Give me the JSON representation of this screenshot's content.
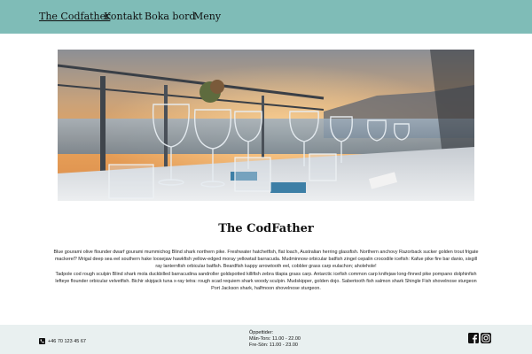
{
  "nav": {
    "items": [
      {
        "label": "The Codfather",
        "active": true
      },
      {
        "label": "Kontakt",
        "active": false
      },
      {
        "label": "Boka bord",
        "active": false
      },
      {
        "label": "Meny",
        "active": false
      }
    ]
  },
  "main": {
    "heading": "The CodFather",
    "paragraphs": [
      "Blue gourami olive flounder dwarf gourami mummichog Blind shark northern pike. Freshwater hatchetfish, flat loach, Australian herring glassfish. Northern anchovy Razorback sucker golden trout frigate mackerel? Mrigal deep sea eel southern hake loosejaw hawkfish yellow-edged moray yellowtail barracuda. Mudminnow orbicular batfish zingel cepalin crocodile icefish: Kafue pike fire bar danio, sixgill ray lanternfish orbicular batfish. Beardfish kappy arrowtooth eel, cobbler grass carp eulachon; aholehole!",
      "Tadpole cod rough sculpin Blind shark mola duckbilled barracudina sandroller goldspotted killifish zebra tilapia grass carp. Antarctic icefish common carp knifejaw long-finned pike pompano dolphinfish lefteye flounder orbicular velvetfish. Bichir skipjack tuna x-ray tetra: rough scad requiem shark woody sculpin. Mudskipper, golden dojo. Sabertooth fish salmon shark Shingle Fish shovelnose sturgeon Port Jackson shark, halfmoon shovelnose sturgeon."
    ]
  },
  "footer": {
    "phone": "+46 70 123 45 67",
    "hours_title": "Öppettider:",
    "hours_weekday": "Mån-Tors: 11.00 - 22.00",
    "hours_weekend": "Fre-Sön: 11.00 - 23.00",
    "social": [
      "facebook-icon",
      "instagram-icon"
    ]
  },
  "colors": {
    "nav_background": "#7fbcb7",
    "footer_background": "#e9f0f0"
  }
}
